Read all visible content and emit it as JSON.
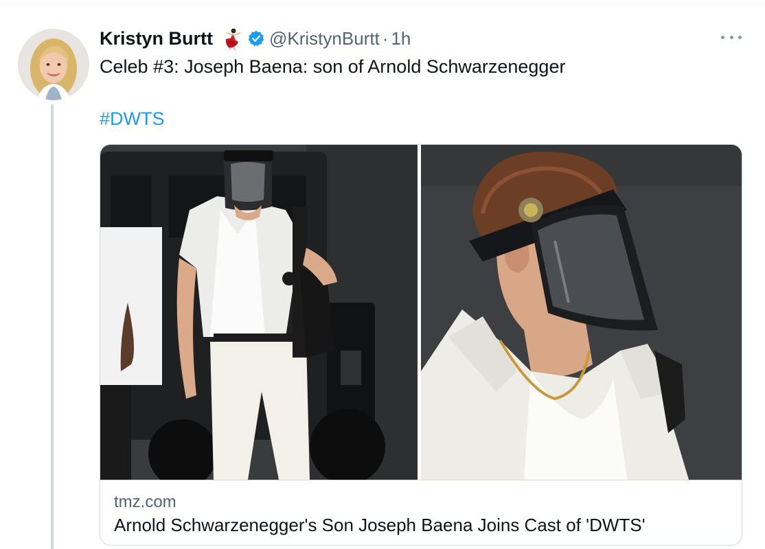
{
  "tweet": {
    "author_name": "Kristyn Burtt",
    "handle": "@KristynBurtt",
    "separator": "·",
    "time": "1h",
    "text": "Celeb #3: Joseph Baena: son of Arnold Schwarzenegger",
    "hashtag": "#DWTS"
  },
  "icons": {
    "avatar": "profile-photo",
    "badge": "dancer-emoji",
    "verified": "verified-badge-icon",
    "more": "more-options-icon"
  },
  "link_card": {
    "domain": "tmz.com",
    "title": "Arnold Schwarzenegger's Son Joseph Baena Joins Cast of 'DWTS'"
  },
  "colors": {
    "link_blue": "#1d9bf0",
    "secondary_text": "#536471",
    "border": "#cfd9de",
    "thread_line": "#cfd9de"
  }
}
